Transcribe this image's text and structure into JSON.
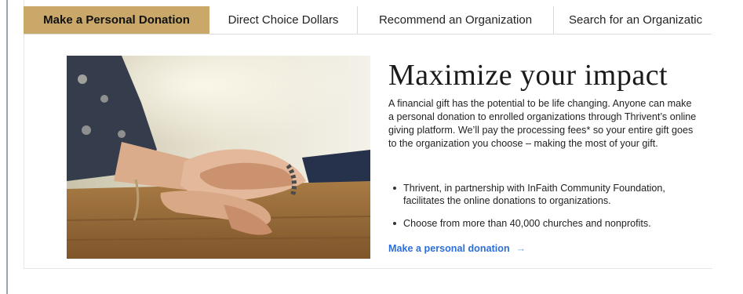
{
  "header_fragment": "page-by",
  "tabs": [
    {
      "label": "Make a Personal Donation",
      "active": true
    },
    {
      "label": "Direct Choice Dollars",
      "active": false
    },
    {
      "label": "Recommend an Organization",
      "active": false
    },
    {
      "label": "Search for an Organizatic",
      "active": false
    }
  ],
  "content": {
    "headline": "Maximize your impact",
    "description": "A financial gift has the potential to be life changing. Anyone can make a personal donation to enrolled organizations through Thrivent’s online giving platform. We’ll pay the processing fees* so your entire gift goes to the organization you choose – making the most of your gift.",
    "bullets": [
      "Thrivent, in partnership with InFaith Community Foundation, facilitates the online donations to organizations.",
      "Choose from more than 40,000 churches and nonprofits."
    ],
    "cta_label": "Make a personal donation",
    "cta_arrow": "→"
  },
  "image": {
    "subject": "hands-holding-photo"
  },
  "colors": {
    "active_tab": "#c9a869",
    "link": "#2c6fd8",
    "frame": "#9aa4b6"
  }
}
